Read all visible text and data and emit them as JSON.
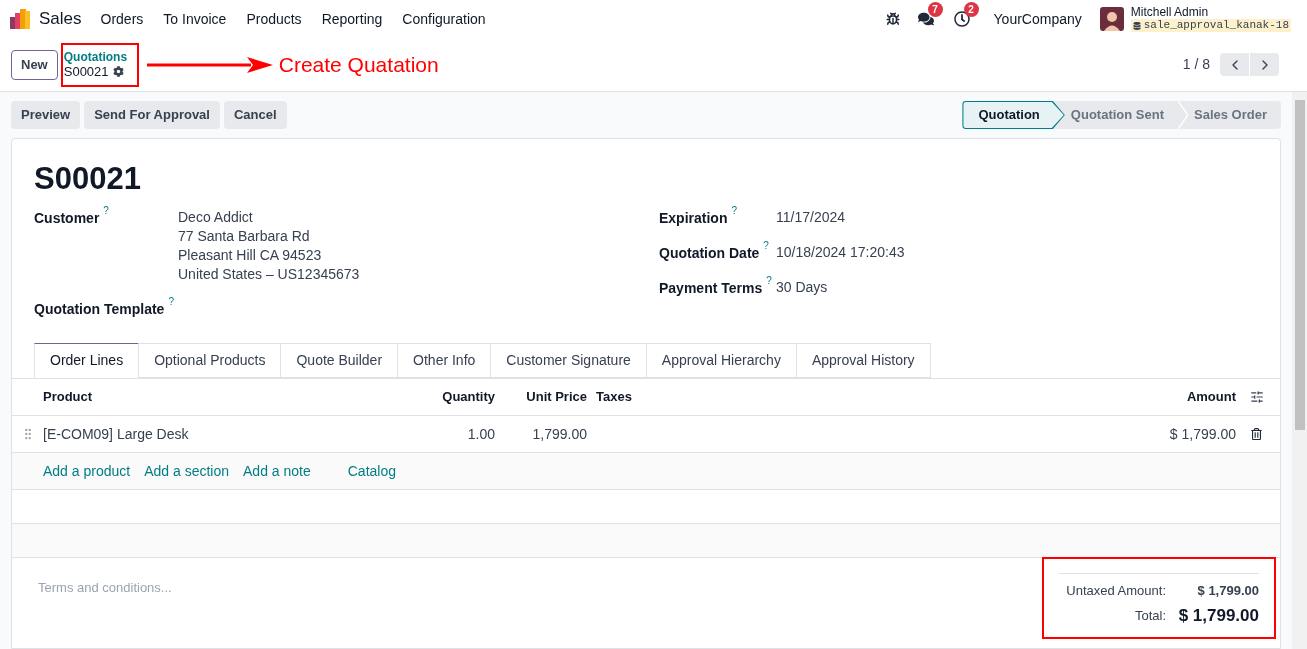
{
  "navbar": {
    "app": "Sales",
    "menu": [
      "Orders",
      "To Invoice",
      "Products",
      "Reporting",
      "Configuration"
    ],
    "notifications": [
      {
        "kind": "messages",
        "count": "7"
      },
      {
        "kind": "activities",
        "count": "2"
      }
    ],
    "company": "YourCompany",
    "user": {
      "name": "Mitchell Admin",
      "database": "sale_approval_kanak-18"
    }
  },
  "control_panel": {
    "new_button": "New",
    "breadcrumb": {
      "parent": "Quotations",
      "current": "S00021"
    },
    "annotation": "Create Quatation",
    "pager": "1 / 8"
  },
  "action_buttons": [
    "Preview",
    "Send For Approval",
    "Cancel"
  ],
  "status_steps": [
    {
      "label": "Quotation",
      "selected": true
    },
    {
      "label": "Quotation Sent",
      "selected": false
    },
    {
      "label": "Sales Order",
      "selected": false
    }
  ],
  "form": {
    "title": "S00021",
    "left_fields": [
      {
        "label": "Customer",
        "help": "?",
        "lines": [
          "Deco Addict",
          "77 Santa Barbara Rd",
          "Pleasant Hill CA 94523",
          "United States – US12345673"
        ]
      },
      {
        "label": "Quotation Template",
        "help": "?"
      }
    ],
    "right_fields": [
      {
        "label": "Expiration",
        "help": "?",
        "lines": [
          "11/17/2024"
        ]
      },
      {
        "label": "Quotation Date",
        "help": "?",
        "lines": [
          "10/18/2024 17:20:43"
        ]
      },
      {
        "label": "Payment Terms",
        "help": "?",
        "lines": [
          "30 Days"
        ]
      }
    ]
  },
  "tabs": [
    {
      "label": "Order Lines",
      "selected": true
    },
    {
      "label": "Optional Products",
      "selected": false
    },
    {
      "label": "Quote Builder",
      "selected": false
    },
    {
      "label": "Other Info",
      "selected": false
    },
    {
      "label": "Customer Signature",
      "selected": false
    },
    {
      "label": "Approval Hierarchy",
      "selected": false
    },
    {
      "label": "Approval History",
      "selected": false
    }
  ],
  "table": {
    "columns": [
      "Product",
      "Quantity",
      "Unit Price",
      "Taxes",
      "Amount"
    ],
    "rows": [
      {
        "product": "[E-COM09] Large Desk",
        "quantity": "1.00",
        "unit_price": "1,799.00",
        "amount": "$ 1,799.00"
      }
    ]
  },
  "add_links": [
    "Add a product",
    "Add a section",
    "Add a note",
    "Catalog"
  ],
  "terms_placeholder": "Terms and conditions...",
  "totals": [
    {
      "label": "Untaxed Amount:",
      "value": "$ 1,799.00",
      "kind": "subtotal"
    },
    {
      "label": "Total:",
      "value": "$ 1,799.00",
      "kind": "grand"
    }
  ]
}
